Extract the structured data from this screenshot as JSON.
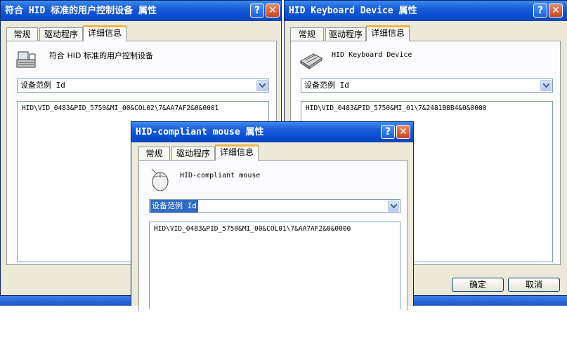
{
  "windows": {
    "left": {
      "title": "符合 HID 标准的用户控制设备 属性",
      "tabs": [
        "常规",
        "驱动程序",
        "详细信息"
      ],
      "device_name": "符合 HID 标准的用户控制设备",
      "property": "设备范例 Id",
      "value": "HID\\VID_0483&PID_5750&MI_00&COL02\\7&AA7AF2&0&0001"
    },
    "right": {
      "title": "HID Keyboard Device 属性",
      "tabs": [
        "常规",
        "驱动程序",
        "详细信息"
      ],
      "device_name": "HID Keyboard Device",
      "property": "设备范例 Id",
      "value": "HID\\VID_0483&PID_5750&MI_01\\7&2481B8B4&0&0000",
      "ok_label": "确定",
      "cancel_label": "取消"
    },
    "front": {
      "title": "HID-compliant mouse 属性",
      "tabs": [
        "常规",
        "驱动程序",
        "详细信息"
      ],
      "device_name": "HID-compliant mouse",
      "property": "设备范例 Id",
      "value": "HID\\VID_0483&PID_5750&MI_00&COL01\\7&AA7AF2&0&0000"
    }
  },
  "titlebar_buttons": {
    "help": "?",
    "close": "✕"
  },
  "icons": [
    "hid-device-icon",
    "keyboard-icon",
    "mouse-icon",
    "help-icon",
    "close-icon",
    "dropdown-arrow-icon"
  ],
  "colors": {
    "titlebar": "#0a4fd4",
    "dialog_bg": "#ece9d8",
    "tab_active_accent": "#f3b446",
    "selection": "#316ac5"
  }
}
